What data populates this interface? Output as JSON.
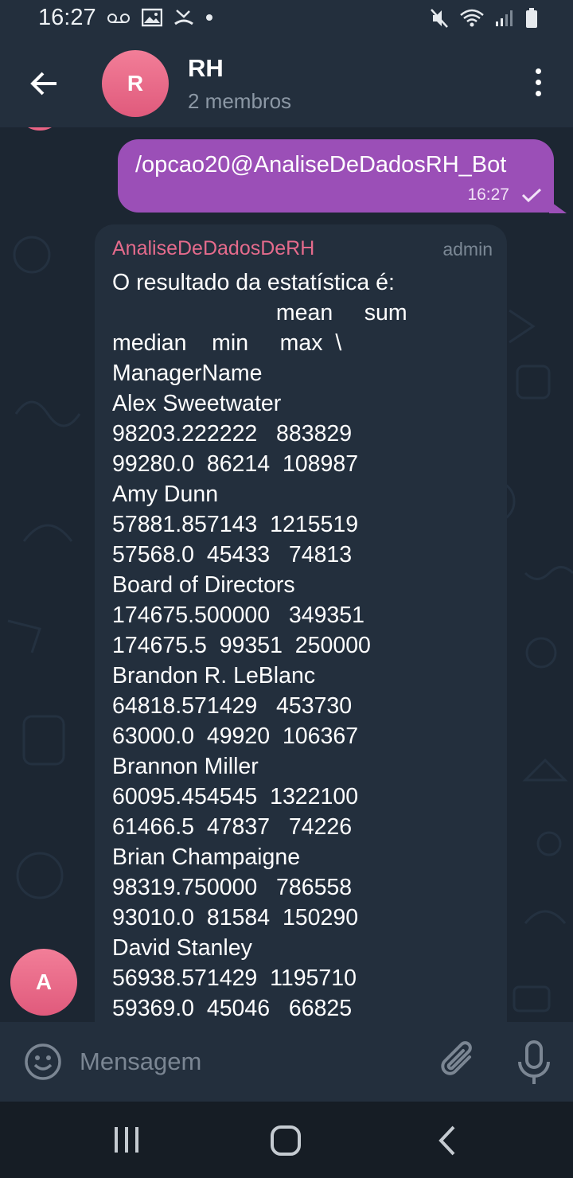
{
  "status_bar": {
    "time": "16:27",
    "left_icons": [
      "voicemail-icon",
      "image-icon",
      "missed-call-icon",
      "dot-icon"
    ],
    "right_icons": [
      "mute-icon",
      "wifi-icon",
      "signal-icon",
      "battery-icon"
    ]
  },
  "header": {
    "avatar_initial": "R",
    "title": "RH",
    "subtitle": "2 membros"
  },
  "messages": {
    "outgoing": {
      "text": "/opcao20@AnaliseDeDadosRH_Bot",
      "time": "16:27"
    },
    "incoming": {
      "sender": "AnaliseDeDadosDeRH",
      "role": "admin",
      "text": "O resultado da estatística é:\n                          mean     sum\nmedian    min     max  \\\nManagerName\nAlex Sweetwater\n98203.222222   883829\n99280.0  86214  108987\nAmy Dunn\n57881.857143  1215519\n57568.0  45433   74813\nBoard of Directors\n174675.500000   349351\n174675.5  99351  250000\nBrandon R. LeBlanc\n64818.571429   453730\n63000.0  49920  106367\nBrannon Miller\n60095.454545  1322100\n61466.5  47837   74226\nBrian Champaigne\n98319.750000   786558\n93010.0  81584  150290\nDavid Stanley\n56938.571429  1195710\n59369.0  45046   66825",
      "avatar_initial": "A"
    }
  },
  "input": {
    "placeholder": "Mensagem"
  },
  "colors": {
    "background": "#1c2632",
    "header": "#232f3d",
    "outgoing_bubble": "#9b4fb7",
    "incoming_bubble": "#232f3d",
    "avatar": "#e96384",
    "sender_name": "#e56b8c"
  }
}
